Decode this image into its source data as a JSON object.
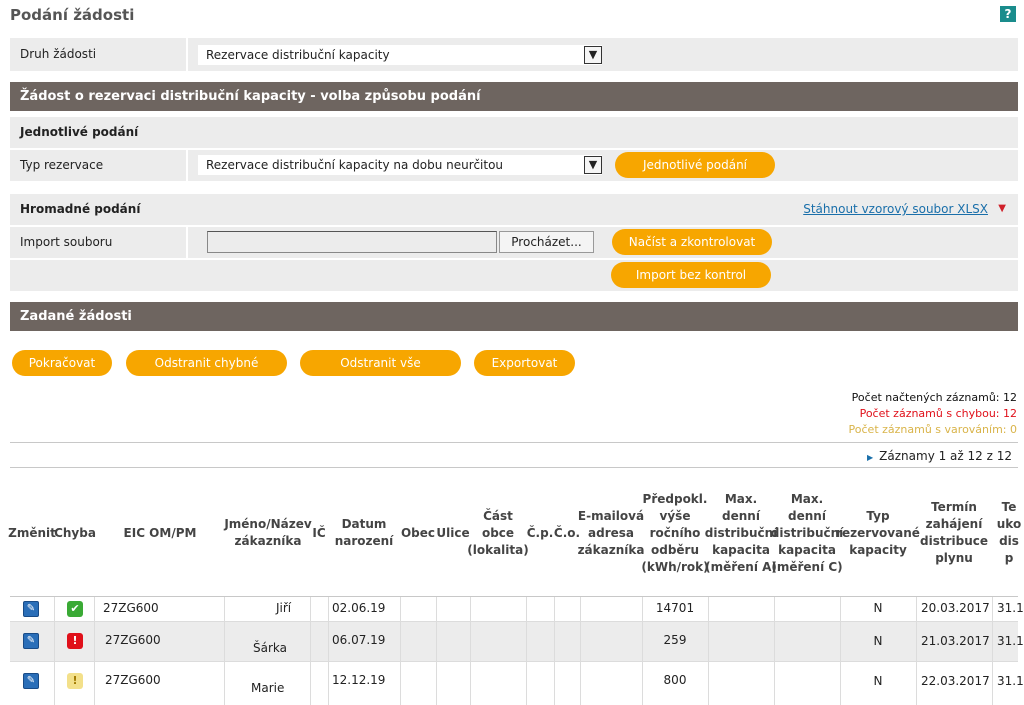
{
  "title": "Podání žádosti",
  "help": "?",
  "druh": {
    "label": "Druh žádosti",
    "value": "Rezervace distribuční kapacity",
    "arrow": "▼"
  },
  "section1": {
    "title": "Žádost o rezervaci distribuční kapacity - volba způsobu podání"
  },
  "single": {
    "heading": "Jednotlivé podání",
    "type_label": "Typ rezervace",
    "type_value": "Rezervace distribuční kapacity na dobu neurčitou",
    "button": "Jednotlivé podání"
  },
  "bulk": {
    "heading": "Hromadné podání",
    "download_link": "Stáhnout vzorový soubor XLSX",
    "import_label": "Import souboru",
    "browse": "Procházet...",
    "load_check": "Načíst a zkontrolovat",
    "import_nocheck": "Import bez kontrol"
  },
  "section2": {
    "title": "Zadané žádosti"
  },
  "actions": {
    "continue": "Pokračovat",
    "remove_err": "Odstranit chybné",
    "remove_all": "Odstranit vše",
    "export": "Exportovat"
  },
  "stats": {
    "loaded": "Počet načtených záznamů: 12",
    "errors": "Počet záznamů s chybou: 12",
    "warnings": "Počet záznamů s varováním: 0"
  },
  "colors": {
    "error": "#e0101a",
    "warning": "#d9b44a",
    "accent": "#f7a600",
    "bar": "#6e6560",
    "ok": "#3aaa35"
  },
  "pager": "Záznamy 1 až 12 z 12",
  "columns": {
    "zmenit": "Změnit",
    "chyba": "Chyba",
    "eic": "EIC OM/PM",
    "jmeno": "Jméno/Název zákazníka",
    "ic": "IČ",
    "datum": "Datum narození",
    "obec": "Obec",
    "ulice": "Ulice",
    "cast": "Část obce (lokalita)",
    "cp": "Č.p.",
    "co": "Č.o.",
    "email": "E-mailová adresa zákazníka",
    "predp": "Předpokl. výše ročního odběru (kWh/rok)",
    "maxa": "Max. denní distribuční kapacita (měření A)",
    "maxc": "Max. denní distribuční kapacita (měření C)",
    "typ": "Typ rezervované kapacity",
    "termin": "Termín zahájení distribuce plynu",
    "te": "Te uko dis p"
  },
  "rows": [
    {
      "eic": "27ZG600",
      "jmeno": "Jiří",
      "datum": "02.06.19",
      "odber": "14701",
      "typ": "N",
      "termin": "20.03.2017",
      "last": "31.1",
      "status": "ok",
      "status_icon": "✔"
    },
    {
      "eic": "27ZG600",
      "jmeno": "Šárka",
      "datum": "06.07.19",
      "odber": "259",
      "typ": "N",
      "termin": "21.03.2017",
      "last": "31.1",
      "status": "error",
      "status_icon": "!"
    },
    {
      "eic": "27ZG600",
      "jmeno": "Marie",
      "datum": "12.12.19",
      "odber": "800",
      "typ": "N",
      "termin": "22.03.2017",
      "last": "31.1",
      "status": "warning",
      "status_icon": "!"
    }
  ],
  "icons": {
    "edit": "pencil-icon",
    "edit_glyph": "✎",
    "download_glyph": "▼",
    "pager_glyph": "▶"
  }
}
